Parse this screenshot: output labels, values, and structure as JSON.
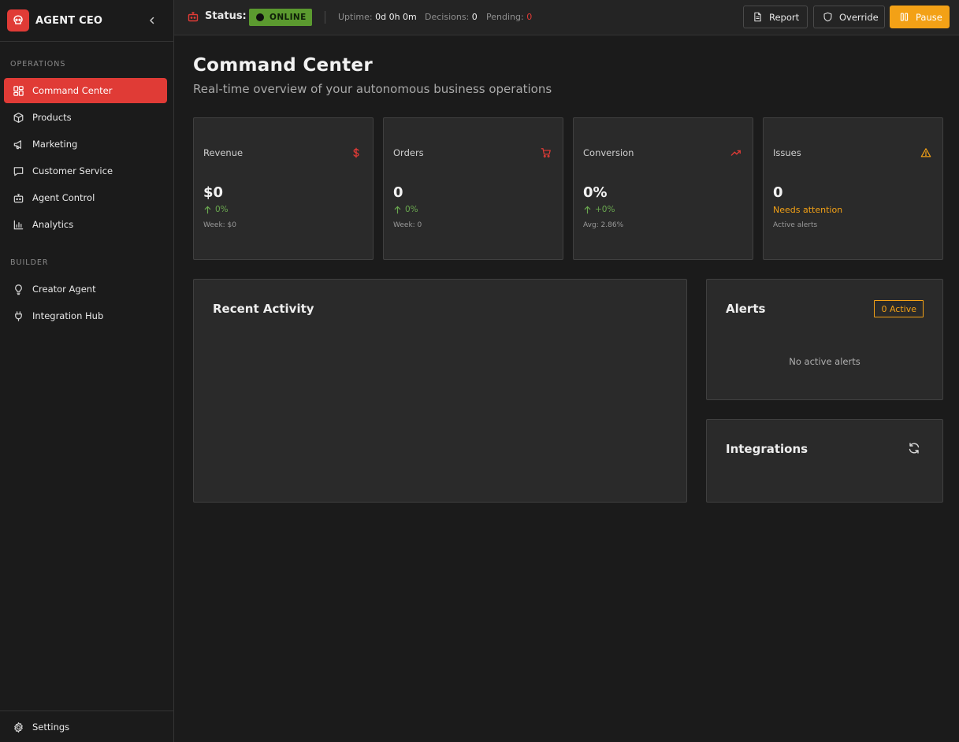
{
  "app": {
    "name": "AGENT CEO"
  },
  "sidebar": {
    "sections": [
      {
        "label": "OPERATIONS"
      },
      {
        "label": "BUILDER"
      }
    ],
    "items": [
      {
        "label": "Command Center",
        "icon": "dashboard-icon",
        "active": true
      },
      {
        "label": "Products",
        "icon": "box-icon"
      },
      {
        "label": "Marketing",
        "icon": "megaphone-icon"
      },
      {
        "label": "Customer Service",
        "icon": "chat-icon"
      },
      {
        "label": "Agent Control",
        "icon": "robot-icon"
      },
      {
        "label": "Analytics",
        "icon": "bar-chart-icon"
      },
      {
        "label": "Creator Agent",
        "icon": "lightbulb-icon"
      },
      {
        "label": "Integration Hub",
        "icon": "plug-icon"
      }
    ],
    "settings_label": "Settings"
  },
  "topbar": {
    "status_label": "Status:",
    "status_value": "ONLINE",
    "uptime_label": "Uptime:",
    "uptime_value": "0d 0h 0m",
    "decisions_label": "Decisions:",
    "decisions_value": "0",
    "pending_label": "Pending:",
    "pending_value": "0",
    "buttons": {
      "report": "Report",
      "override": "Override",
      "pause": "Pause"
    }
  },
  "page": {
    "title": "Command Center",
    "subtitle": "Real-time overview of your autonomous business operations"
  },
  "stats": [
    {
      "label": "Revenue",
      "value": "$0",
      "change": "0%",
      "sub": "Week: $0",
      "icon": "dollar-icon"
    },
    {
      "label": "Orders",
      "value": "0",
      "change": "0%",
      "sub": "Week: 0",
      "icon": "cart-icon"
    },
    {
      "label": "Conversion",
      "value": "0%",
      "change": "+0%",
      "sub": "Avg: 2.86%",
      "icon": "trending-up-icon"
    },
    {
      "label": "Issues",
      "value": "0",
      "attention": "Needs attention",
      "sub": "Active alerts",
      "icon": "warning-icon"
    }
  ],
  "panels": {
    "activity_title": "Recent Activity",
    "alerts_title": "Alerts",
    "alerts_badge": "0 Active",
    "alerts_empty": "No active alerts",
    "integrations_title": "Integrations"
  },
  "colors": {
    "accent": "#e03b36",
    "online": "#5b9a2f",
    "warning": "#f3a116",
    "positive": "#6aa84f"
  }
}
